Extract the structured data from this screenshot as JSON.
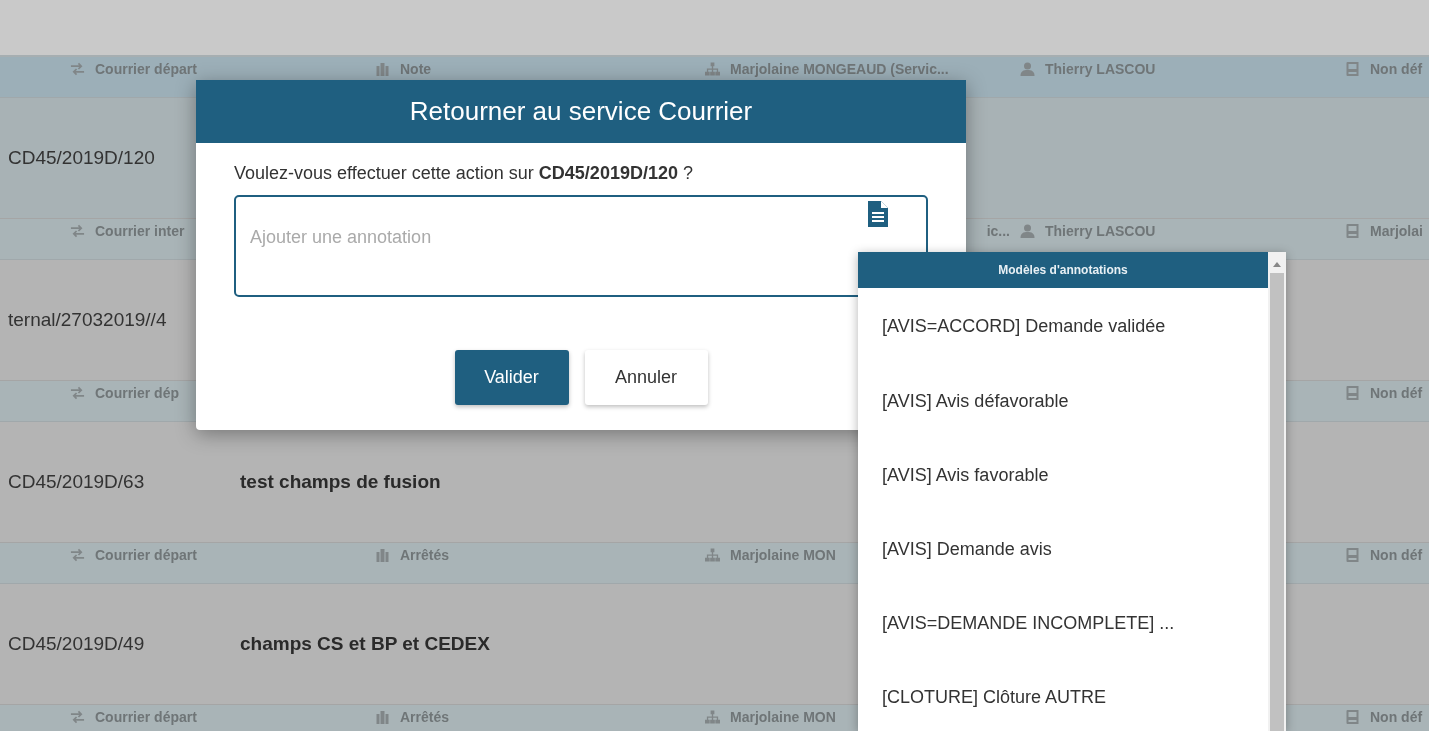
{
  "rows": [
    {
      "selected": true,
      "type": "Courrier départ",
      "category": "Note",
      "entity": "Marjolaine MONGEAUD (Servic...",
      "user": "Thierry LASCOU",
      "status": "Non déf",
      "reference": "CD45/2019D/120"
    },
    {
      "selected": false,
      "type": "Courrier inter",
      "entity_tail": "ic...",
      "user": "Thierry LASCOU",
      "status": "Marjolai",
      "reference": "ternal/27032019//4"
    },
    {
      "selected": false,
      "type": "Courrier dép",
      "status": "Non déf",
      "reference": "CD45/2019D/63",
      "subject": "test champs de fusion"
    },
    {
      "selected": false,
      "type": "Courrier départ",
      "category": "Arrêtés",
      "entity": "Marjolaine MON",
      "status": "Non déf",
      "reference": "CD45/2019D/49",
      "subject": "champs CS et BP et CEDEX"
    },
    {
      "selected": false,
      "type": "Courrier départ",
      "category": "Arrêtés",
      "entity": "Marjolaine MON",
      "status": "Non déf"
    }
  ],
  "dialog": {
    "title": "Retourner au service Courrier",
    "question": "Voulez-vous effectuer cette action sur **CD45/2019D/120** ?",
    "annotation": {
      "placeholder": "Ajouter une annotation"
    },
    "buttons": [
      {
        "label": "Valider",
        "kind": "primary"
      },
      {
        "label": "Annuler",
        "kind": "secondary"
      }
    ]
  },
  "templates": {
    "title": "Modèles d'annotations",
    "items": [
      "[AVIS=ACCORD] Demande validée",
      "[AVIS] Avis défavorable",
      "[AVIS] Avis favorable",
      "[AVIS] Demande avis",
      "[AVIS=DEMANDE INCOMPLETE] ...",
      "[CLOTURE] Clôture AUTRE"
    ]
  }
}
